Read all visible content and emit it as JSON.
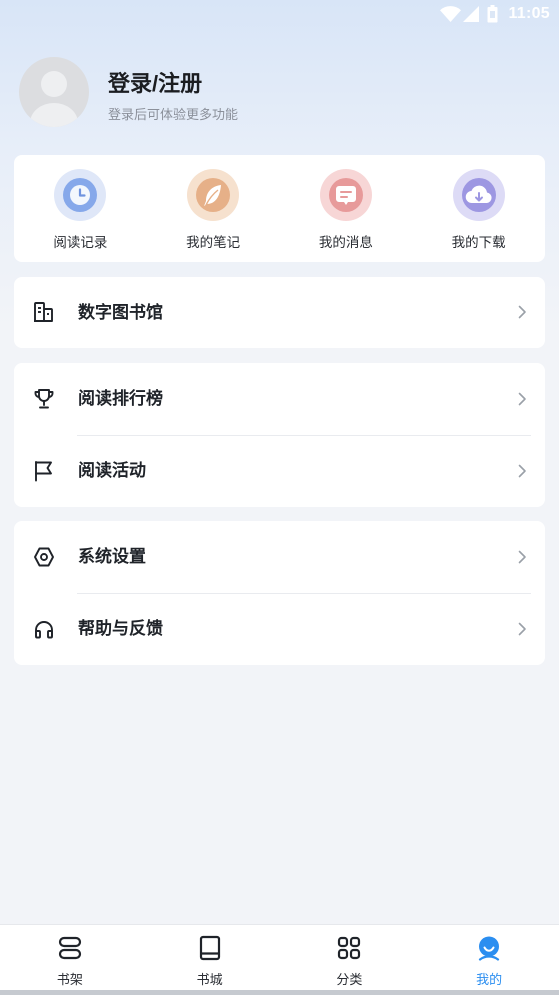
{
  "status_bar": {
    "time": "11:05",
    "icons": [
      "wifi-icon",
      "signal-icon",
      "battery-icon"
    ]
  },
  "profile": {
    "title": "登录/注册",
    "subtitle": "登录后可体验更多功能",
    "avatar_icon": "avatar-placeholder-icon"
  },
  "quick_actions": [
    {
      "label": "阅读记录",
      "icon": "clock-icon",
      "color": "#86a8ea"
    },
    {
      "label": "我的笔记",
      "icon": "feather-icon",
      "color": "#e6b088"
    },
    {
      "label": "我的消息",
      "icon": "message-icon",
      "color": "#e79a9a"
    },
    {
      "label": "我的下载",
      "icon": "cloud-download-icon",
      "color": "#9d97e2"
    }
  ],
  "menu_groups": [
    {
      "items": [
        {
          "label": "数字图书馆",
          "icon": "library-building-icon"
        }
      ]
    },
    {
      "items": [
        {
          "label": "阅读排行榜",
          "icon": "trophy-icon"
        },
        {
          "label": "阅读活动",
          "icon": "flag-icon"
        }
      ]
    },
    {
      "items": [
        {
          "label": "系统设置",
          "icon": "settings-hexagon-icon"
        },
        {
          "label": "帮助与反馈",
          "icon": "headphones-icon"
        }
      ]
    }
  ],
  "bottom_nav": {
    "items": [
      {
        "label": "书架",
        "icon": "bookshelf-icon",
        "active": false
      },
      {
        "label": "书城",
        "icon": "book-icon",
        "active": false
      },
      {
        "label": "分类",
        "icon": "category-grid-icon",
        "active": false
      },
      {
        "label": "我的",
        "icon": "profile-icon",
        "active": true
      }
    ]
  },
  "colors": {
    "accent": "#2b8ef0",
    "text_primary": "#1f2329",
    "text_secondary": "#8b909a",
    "background": "#f2f4f8",
    "card": "#ffffff",
    "chevron": "#9aa0a8"
  }
}
